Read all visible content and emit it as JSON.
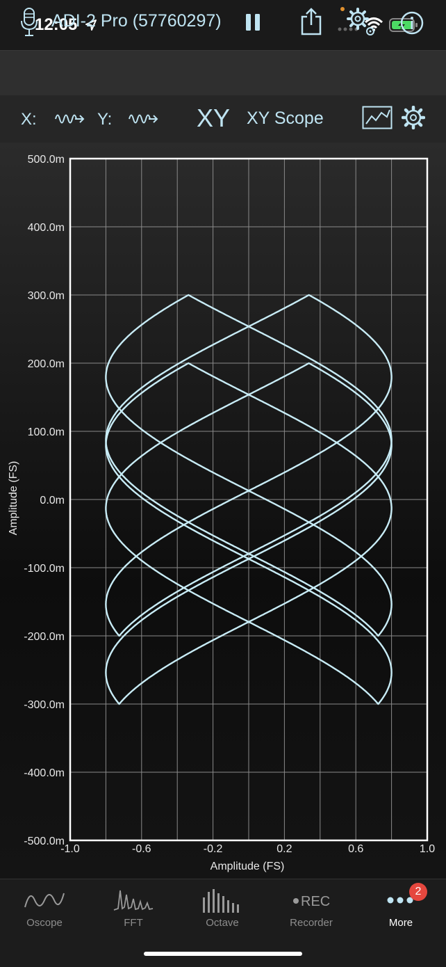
{
  "status_bar": {
    "time": "12:05"
  },
  "toolbar": {
    "device_name": "ADI-2 Pro (57760297)"
  },
  "mode_bar": {
    "x_label": "X:",
    "y_label": "Y:",
    "mode_symbol": "XY",
    "scope_title": "XY Scope"
  },
  "tab_bar": {
    "tabs": [
      {
        "label": "Oscope",
        "icon": "sine-wave-icon"
      },
      {
        "label": "FFT",
        "icon": "fft-spectrum-icon"
      },
      {
        "label": "Octave",
        "icon": "octave-bars-icon"
      },
      {
        "label": "Recorder",
        "icon": "rec-icon",
        "icon_text": "REC"
      },
      {
        "label": "More",
        "icon": "more-dots-icon",
        "badge": "2",
        "active": true
      }
    ]
  },
  "colors": {
    "trace": "#c8ecf6",
    "accent_text": "#bfe4f2",
    "grid": "#8a8a8a",
    "badge": "#e5473e"
  },
  "chart_data": {
    "type": "scatter",
    "xlabel": "Amplitude (FS)",
    "ylabel": "Amplitude (FS)",
    "xlim": [
      -1.0,
      1.0
    ],
    "ylim": [
      -0.5,
      0.5
    ],
    "x_ticks": [
      -1.0,
      -0.8,
      -0.6,
      -0.4,
      -0.2,
      0.0,
      0.2,
      0.4,
      0.6,
      0.8,
      1.0
    ],
    "x_tick_labels": [
      "-1.0",
      "-0.6",
      "-0.2",
      "0.2",
      "0.6",
      "1.0"
    ],
    "y_ticks": [
      0.5,
      0.4,
      0.3,
      0.2,
      0.1,
      0.0,
      -0.1,
      -0.2,
      -0.3,
      -0.4,
      -0.5
    ],
    "y_tick_labels": [
      "500.0m",
      "400.0m",
      "300.0m",
      "200.0m",
      "100.0m",
      "0.0m",
      "-100.0m",
      "-200.0m",
      "-300.0m",
      "-400.0m",
      "-500.0m"
    ],
    "grid": true,
    "series": [
      {
        "x": [
          -0.8,
          -0.77,
          -0.7,
          -0.62,
          -0.5,
          -0.3,
          -0.1,
          0.1,
          0.3,
          0.48,
          0.6,
          0.68,
          0.77,
          0.8,
          0.78,
          0.7,
          0.62,
          0.5,
          0.3,
          0.1,
          -0.1,
          -0.3,
          -0.48,
          -0.6,
          -0.68,
          -0.77,
          -0.8
        ],
        "y": [
          -0.25,
          -0.2,
          -0.14,
          -0.08,
          -0.0,
          0.09,
          0.17,
          0.2,
          0.25,
          0.25,
          0.14,
          0.05,
          -0.05,
          -0.1,
          -0.17,
          -0.22,
          -0.25,
          -0.16,
          -0.05,
          0.06,
          0.11,
          0.05,
          0.04,
          0.08,
          0.13,
          0.18,
          0.2
        ]
      }
    ]
  }
}
